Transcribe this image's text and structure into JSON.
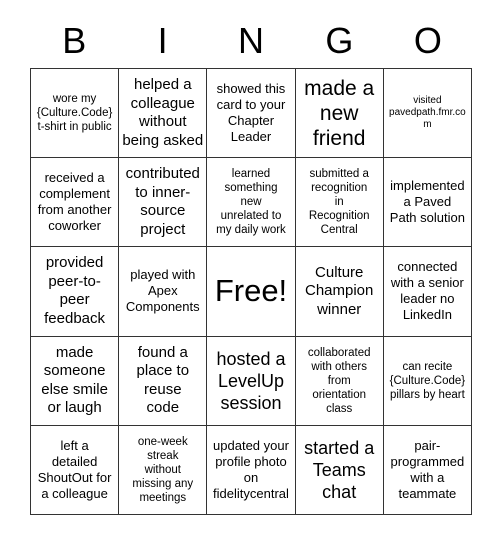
{
  "card": {
    "header_letters": [
      "B",
      "I",
      "N",
      "G",
      "O"
    ],
    "free_space_label": "Free!",
    "colors": {
      "background": "#ffffff",
      "text": "#000000",
      "grid_line": "#333333"
    },
    "rows": [
      [
        {
          "text": "wore my\n{Culture.Code}\nt-shirt in public",
          "size": "sm"
        },
        {
          "text": "helped a\ncolleague\nwithout\nbeing asked",
          "size": "lg"
        },
        {
          "text": "showed this\ncard to your\nChapter\nLeader",
          "size": "md"
        },
        {
          "text": "made a\nnew\nfriend",
          "size": "xxl"
        },
        {
          "text": "visited\npavedpath.fmr.com",
          "size": "xs"
        }
      ],
      [
        {
          "text": "received a\ncomplement\nfrom another\ncoworker",
          "size": "md"
        },
        {
          "text": "contributed\nto inner-\nsource\nproject",
          "size": "lg"
        },
        {
          "text": "learned\nsomething\nnew\nunrelated to\nmy daily work",
          "size": "sm"
        },
        {
          "text": "submitted a\nrecognition\nin\nRecognition\nCentral",
          "size": "sm"
        },
        {
          "text": "implemented\na Paved\nPath solution",
          "size": "md"
        }
      ],
      [
        {
          "text": "provided\npeer-to-\npeer\nfeedback",
          "size": "lg"
        },
        {
          "text": "played with\nApex\nComponents",
          "size": "md"
        },
        {
          "text": "Free!",
          "size": "free"
        },
        {
          "text": "Culture\nChampion\nwinner",
          "size": "lg"
        },
        {
          "text": "connected\nwith a senior\nleader no\nLinkedIn",
          "size": "md"
        }
      ],
      [
        {
          "text": "made\nsomeone\nelse smile\nor laugh",
          "size": "lg"
        },
        {
          "text": "found a\nplace to\nreuse\ncode",
          "size": "lg"
        },
        {
          "text": "hosted a\nLevelUp\nsession",
          "size": "xl"
        },
        {
          "text": "collaborated\nwith others\nfrom\norientation\nclass",
          "size": "sm"
        },
        {
          "text": "can recite\n{Culture.Code}\npillars by heart",
          "size": "sm"
        }
      ],
      [
        {
          "text": "left a\ndetailed\nShoutOut for\na colleague",
          "size": "md"
        },
        {
          "text": "one-week\nstreak\nwithout\nmissing any\nmeetings",
          "size": "sm"
        },
        {
          "text": "updated your\nprofile photo\non\nfidelitycentral",
          "size": "md"
        },
        {
          "text": "started a\nTeams\nchat",
          "size": "xl"
        },
        {
          "text": "pair-\nprogrammed\nwith a\nteammate",
          "size": "md"
        }
      ]
    ]
  }
}
